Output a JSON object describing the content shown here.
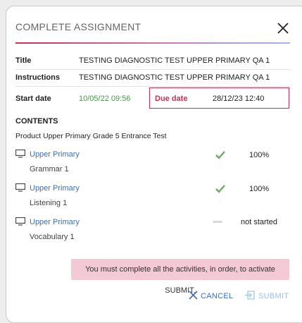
{
  "header": {
    "title": "COMPLETE ASSIGNMENT"
  },
  "assignment": {
    "title_label": "Title",
    "title_value": "TESTING DIAGNOSTIC TEST UPPER PRIMARY QA 1",
    "instructions_label": "Instructions",
    "instructions_value": "TESTING DIAGNOSTIC TEST UPPER PRIMARY QA 1",
    "start_label": "Start date",
    "start_value": "10/05/22 09:56",
    "due_label": "Due date",
    "due_value": "28/12/23 12:40"
  },
  "contents": {
    "heading": "CONTENTS",
    "product": "Product Upper Primary Grade 5 Entrance Test",
    "items": [
      {
        "link": "Upper Primary",
        "sub": "Grammar 1",
        "status_icon": "check-icon",
        "status": "100%"
      },
      {
        "link": "Upper Primary",
        "sub": "Listening 1",
        "status_icon": "check-icon",
        "status": "100%"
      },
      {
        "link": "Upper Primary",
        "sub": "Vocabulary 1",
        "status_icon": "dash-icon",
        "status": "not started"
      }
    ]
  },
  "notice": "You must complete all the activities, in order, to activate SUBMIT.",
  "actions": {
    "cancel": "CANCEL",
    "submit": "SUBMIT"
  },
  "colors": {
    "accent_red": "#d92a4e",
    "link_blue": "#3a6fbf",
    "check_green": "#6aaa64",
    "notice_pink": "#f4c9d6"
  }
}
